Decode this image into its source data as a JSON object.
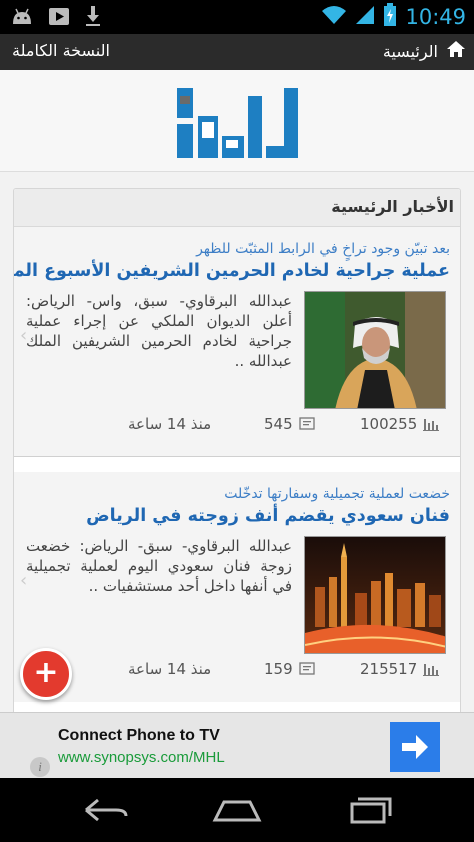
{
  "status_bar": {
    "time": "10:49",
    "icons": [
      "android-icon",
      "play-store-icon",
      "download-icon",
      "wifi-icon",
      "signal-icon",
      "battery-icon"
    ]
  },
  "action_bar": {
    "home_label": "الرئيسية",
    "full_version_label": "النسخة الكاملة"
  },
  "section": {
    "title": "الأخبار الرئيسية"
  },
  "articles": [
    {
      "kicker": "بعد تبيّن وجود تراخٍ في الرابط المثبّت للظهر",
      "headline": "عملية جراحية لخادم الحرمين الشريفين الأسبوع المقبل",
      "excerpt": "عبدالله البرقاوي- سبق، واس- الرياض: أعلن الديوان الملكي عن إجراء عملية جراحية لخادم الحرمين الشريفين الملك عبدالله ..",
      "views": "100255",
      "comments": "545",
      "time": "منذ 14 ساعة"
    },
    {
      "kicker": "خضعت لعملية تجميلية وسفارتها تدخّلت",
      "headline": "فنان سعودي يقضم أنف زوجته في الرياض",
      "excerpt": "عبدالله البرقاوي- سبق- الرياض: خضعت زوجة فنان سعودي اليوم لعملية تجميلية في أنفها داخل أحد مستشفيات ..",
      "views": "215517",
      "comments": "159",
      "time": "منذ 14 ساعة"
    }
  ],
  "ad": {
    "title": "Connect Phone to TV",
    "url": "www.synopsys.com/MHL",
    "info": "i"
  },
  "fab": {
    "label": "+"
  },
  "colors": {
    "accent_blue": "#1f67b3",
    "kicker_blue": "#3d7ec6",
    "fab_red": "#e33a2e",
    "ad_green": "#1a9b3a",
    "status_time": "#33b5e5"
  }
}
